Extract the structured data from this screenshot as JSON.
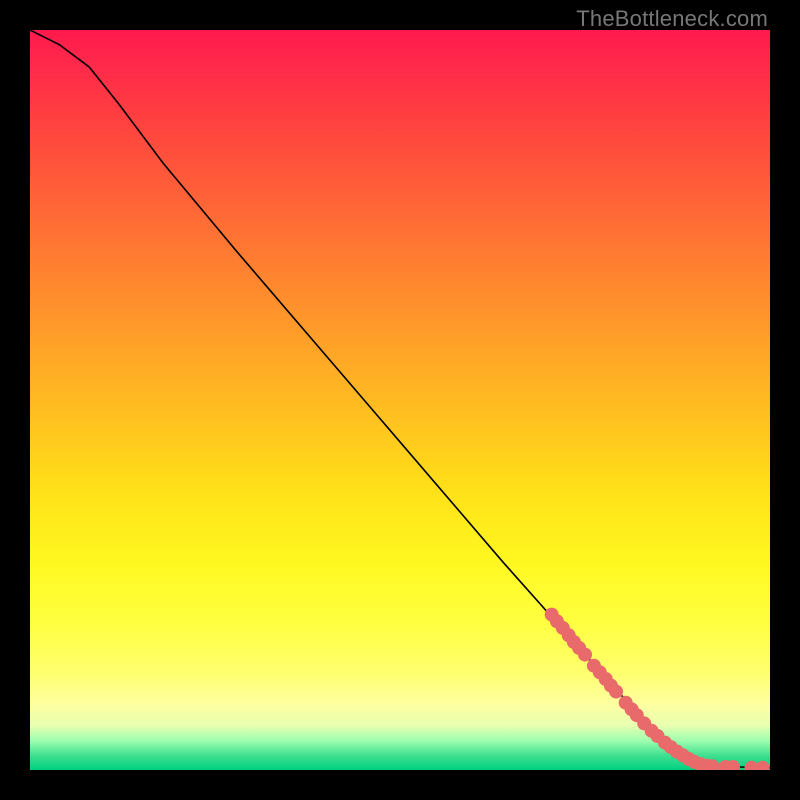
{
  "watermark": "TheBottleneck.com",
  "chart_data": {
    "type": "line",
    "title": "",
    "xlabel": "",
    "ylabel": "",
    "xlim": [
      0,
      100
    ],
    "ylim": [
      0,
      100
    ],
    "curve": [
      {
        "x": 0,
        "y": 100
      },
      {
        "x": 4,
        "y": 98
      },
      {
        "x": 8,
        "y": 95
      },
      {
        "x": 12,
        "y": 90
      },
      {
        "x": 18,
        "y": 82
      },
      {
        "x": 28,
        "y": 70
      },
      {
        "x": 40,
        "y": 56
      },
      {
        "x": 52,
        "y": 42
      },
      {
        "x": 64,
        "y": 28
      },
      {
        "x": 72,
        "y": 19
      },
      {
        "x": 80,
        "y": 10
      },
      {
        "x": 86,
        "y": 4
      },
      {
        "x": 89,
        "y": 1.5
      },
      {
        "x": 92,
        "y": 0.6
      },
      {
        "x": 96,
        "y": 0.4
      },
      {
        "x": 100,
        "y": 0.3
      }
    ],
    "markers": [
      {
        "x": 70.5,
        "y": 21.0
      },
      {
        "x": 71.2,
        "y": 20.1
      },
      {
        "x": 72.0,
        "y": 19.2
      },
      {
        "x": 72.8,
        "y": 18.2
      },
      {
        "x": 73.5,
        "y": 17.3
      },
      {
        "x": 74.2,
        "y": 16.5
      },
      {
        "x": 75.0,
        "y": 15.6
      },
      {
        "x": 76.2,
        "y": 14.1
      },
      {
        "x": 77.0,
        "y": 13.2
      },
      {
        "x": 77.8,
        "y": 12.3
      },
      {
        "x": 78.5,
        "y": 11.4
      },
      {
        "x": 79.2,
        "y": 10.6
      },
      {
        "x": 80.5,
        "y": 9.1
      },
      {
        "x": 81.3,
        "y": 8.2
      },
      {
        "x": 82.0,
        "y": 7.4
      },
      {
        "x": 83.0,
        "y": 6.3
      },
      {
        "x": 84.0,
        "y": 5.3
      },
      {
        "x": 84.8,
        "y": 4.6
      },
      {
        "x": 85.8,
        "y": 3.7
      },
      {
        "x": 86.6,
        "y": 3.1
      },
      {
        "x": 87.4,
        "y": 2.5
      },
      {
        "x": 88.2,
        "y": 2.0
      },
      {
        "x": 89.0,
        "y": 1.5
      },
      {
        "x": 89.8,
        "y": 1.1
      },
      {
        "x": 90.6,
        "y": 0.8
      },
      {
        "x": 91.4,
        "y": 0.6
      },
      {
        "x": 92.2,
        "y": 0.5
      },
      {
        "x": 94.0,
        "y": 0.4
      },
      {
        "x": 95.0,
        "y": 0.4
      },
      {
        "x": 97.5,
        "y": 0.3
      },
      {
        "x": 99.0,
        "y": 0.3
      }
    ],
    "marker_color": "#e96a6a",
    "marker_radius_px": 7
  }
}
